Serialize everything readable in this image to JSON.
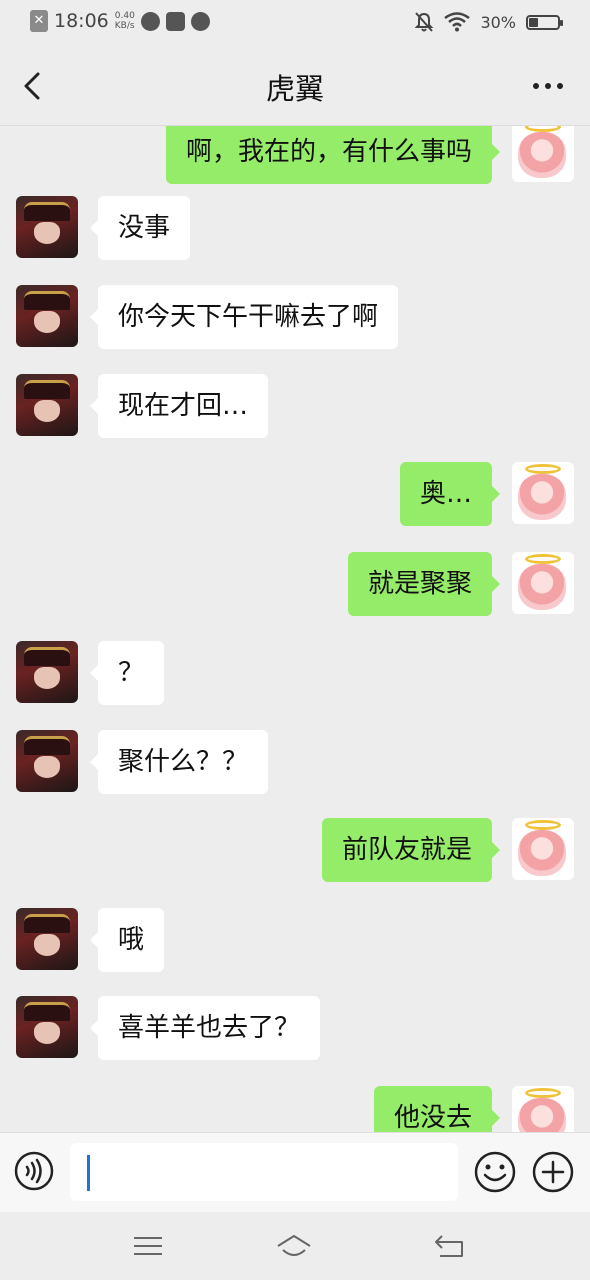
{
  "status_bar": {
    "time": "18:06",
    "speed_top": "0.40",
    "speed_bottom": "KB/s",
    "notification_icon": "x-notification-icon",
    "battery_label": "30%",
    "battery_level": 0.3
  },
  "header": {
    "title": "虎翼",
    "back_icon": "chevron-left-icon",
    "more_icon": "more-dots-icon"
  },
  "messages": [
    {
      "side": "right",
      "text": "啊，我在的，有什么事吗"
    },
    {
      "side": "left",
      "text": "没事"
    },
    {
      "side": "left",
      "text": "你今天下午干嘛去了啊"
    },
    {
      "side": "left",
      "text": "现在才回…"
    },
    {
      "side": "right",
      "text": "奥…"
    },
    {
      "side": "right",
      "text": "就是聚聚"
    },
    {
      "side": "left",
      "text": "？"
    },
    {
      "side": "left",
      "text": "聚什么？？"
    },
    {
      "side": "right",
      "text": "前队友就是"
    },
    {
      "side": "left",
      "text": "哦"
    },
    {
      "side": "left",
      "text": "喜羊羊也去了？"
    },
    {
      "side": "right",
      "text": "他没去"
    }
  ],
  "input_bar": {
    "value": "",
    "voice_icon": "voice-icon",
    "emoji_icon": "emoji-icon",
    "plus_icon": "plus-icon"
  },
  "nav_bar": {
    "menu_icon": "menu-icon",
    "home_icon": "home-icon",
    "back_icon": "back-arrow-icon"
  },
  "colors": {
    "background": "#ededed",
    "my_bubble": "#95ec69",
    "their_bubble": "#ffffff",
    "caret": "#1f75d6"
  }
}
